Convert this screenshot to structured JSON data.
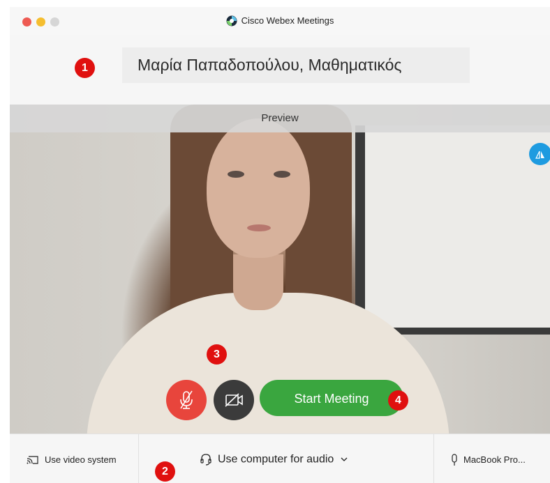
{
  "window": {
    "title": "Cisco Webex Meetings"
  },
  "name_field": {
    "value": "Μαρία Παπαδοπούλου, Μαθηματικός"
  },
  "preview": {
    "label": "Preview"
  },
  "controls": {
    "start_label": "Start Meeting"
  },
  "bottom_bar": {
    "video_system_label": "Use video system",
    "audio_label": "Use computer for audio",
    "mic_label": "MacBook Pro..."
  },
  "annotations": [
    "1",
    "2",
    "3",
    "4"
  ],
  "colors": {
    "start_green": "#3aa63f",
    "mute_red": "#e8453c",
    "badge_red": "#e0100f",
    "flip_blue": "#1e9be0"
  },
  "icons": {
    "app_logo": "webex-logo",
    "mute": "mic-muted-icon",
    "video": "video-off-icon",
    "flip": "flip-icon",
    "video_system": "cast-icon",
    "audio": "headset-icon",
    "mic": "microphone-icon",
    "dropdown": "chevron-down-icon"
  }
}
